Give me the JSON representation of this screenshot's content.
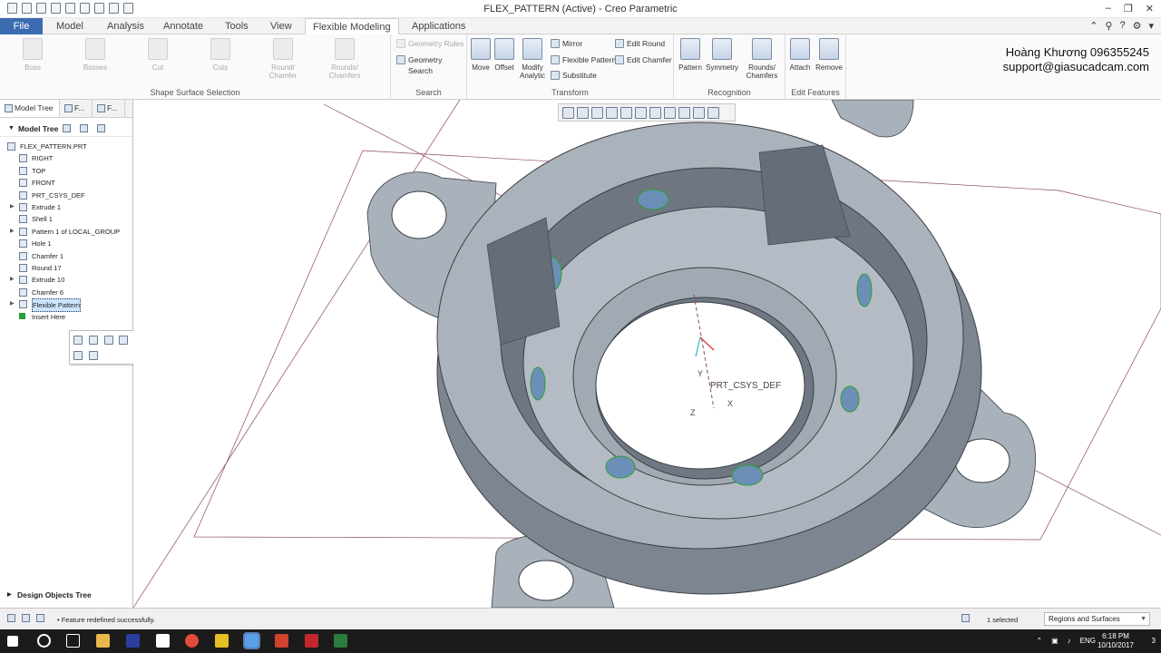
{
  "window": {
    "title": "FLEX_PATTERN (Active) - Creo Parametric"
  },
  "tabs": {
    "file": "File",
    "items": [
      "Model",
      "Analysis",
      "Annotate",
      "Tools",
      "View",
      "Flexible Modeling",
      "Applications"
    ],
    "active": "Flexible Modeling"
  },
  "ribbon": {
    "shape": {
      "title": "Shape Surface Selection",
      "buttons": [
        "Boss",
        "Bosses",
        "Cut",
        "Cuts",
        "Round/\nChamfer",
        "Rounds/\nChamfers"
      ]
    },
    "search": {
      "title": "Search",
      "rules": "Geometry Rules",
      "search": "Geometry Search"
    },
    "transform": {
      "title": "Transform",
      "move": "Move",
      "offset": "Offset",
      "modify": "Modify\nAnalytic",
      "mirror": "Mirror",
      "flexpattern": "Flexible Pattern",
      "substitute": "Substitute",
      "editround": "Edit Round",
      "editchamfer": "Edit Chamfer"
    },
    "recognition": {
      "title": "Recognition",
      "pattern": "Pattern",
      "symmetry": "Symmetry",
      "rounds": "Rounds/\nChamfers"
    },
    "edit": {
      "title": "Edit Features",
      "attach": "Attach",
      "remove": "Remove"
    }
  },
  "brand": {
    "line1": "Hoàng Khương 096355245",
    "line2": "support@giasucadcam.com"
  },
  "panel": {
    "tabs": [
      "Model Tree",
      "F...",
      "F..."
    ],
    "header": "Model Tree",
    "items": [
      {
        "label": "FLEX_PATTERN.PRT",
        "icon": "part-icon"
      },
      {
        "label": "RIGHT",
        "icon": "datum-plane-icon"
      },
      {
        "label": "TOP",
        "icon": "datum-plane-icon"
      },
      {
        "label": "FRONT",
        "icon": "datum-plane-icon"
      },
      {
        "label": "PRT_CSYS_DEF",
        "icon": "csys-icon"
      },
      {
        "label": "Extrude 1",
        "icon": "extrude-icon"
      },
      {
        "label": "Shell 1",
        "icon": "shell-icon"
      },
      {
        "label": "Pattern 1 of LOCAL_GROUP",
        "icon": "pattern-icon"
      },
      {
        "label": "Hole 1",
        "icon": "hole-icon"
      },
      {
        "label": "Chamfer 1",
        "icon": "chamfer-icon"
      },
      {
        "label": "Round 17",
        "icon": "round-icon"
      },
      {
        "label": "Extrude 10",
        "icon": "extrude-icon"
      },
      {
        "label": "Chamfer 6",
        "icon": "chamfer-icon"
      },
      {
        "label": "Flexible Pattern",
        "icon": "flex-pattern-icon"
      },
      {
        "label": "Insert Here",
        "icon": "insert-here-icon"
      }
    ],
    "design_tree": "Design Objects Tree"
  },
  "viewport": {
    "csys_label": "PRT_CSYS_DEF",
    "axis_x": "X",
    "axis_y": "Y",
    "axis_z": "Z"
  },
  "status": {
    "message": "Feature redefined successfully.",
    "selected": "1 selected",
    "filter": "Regions and Surfaces"
  },
  "taskbar": {
    "lang": "ENG",
    "time": "6:18 PM",
    "date": "10/10/2017",
    "notif": "3"
  }
}
